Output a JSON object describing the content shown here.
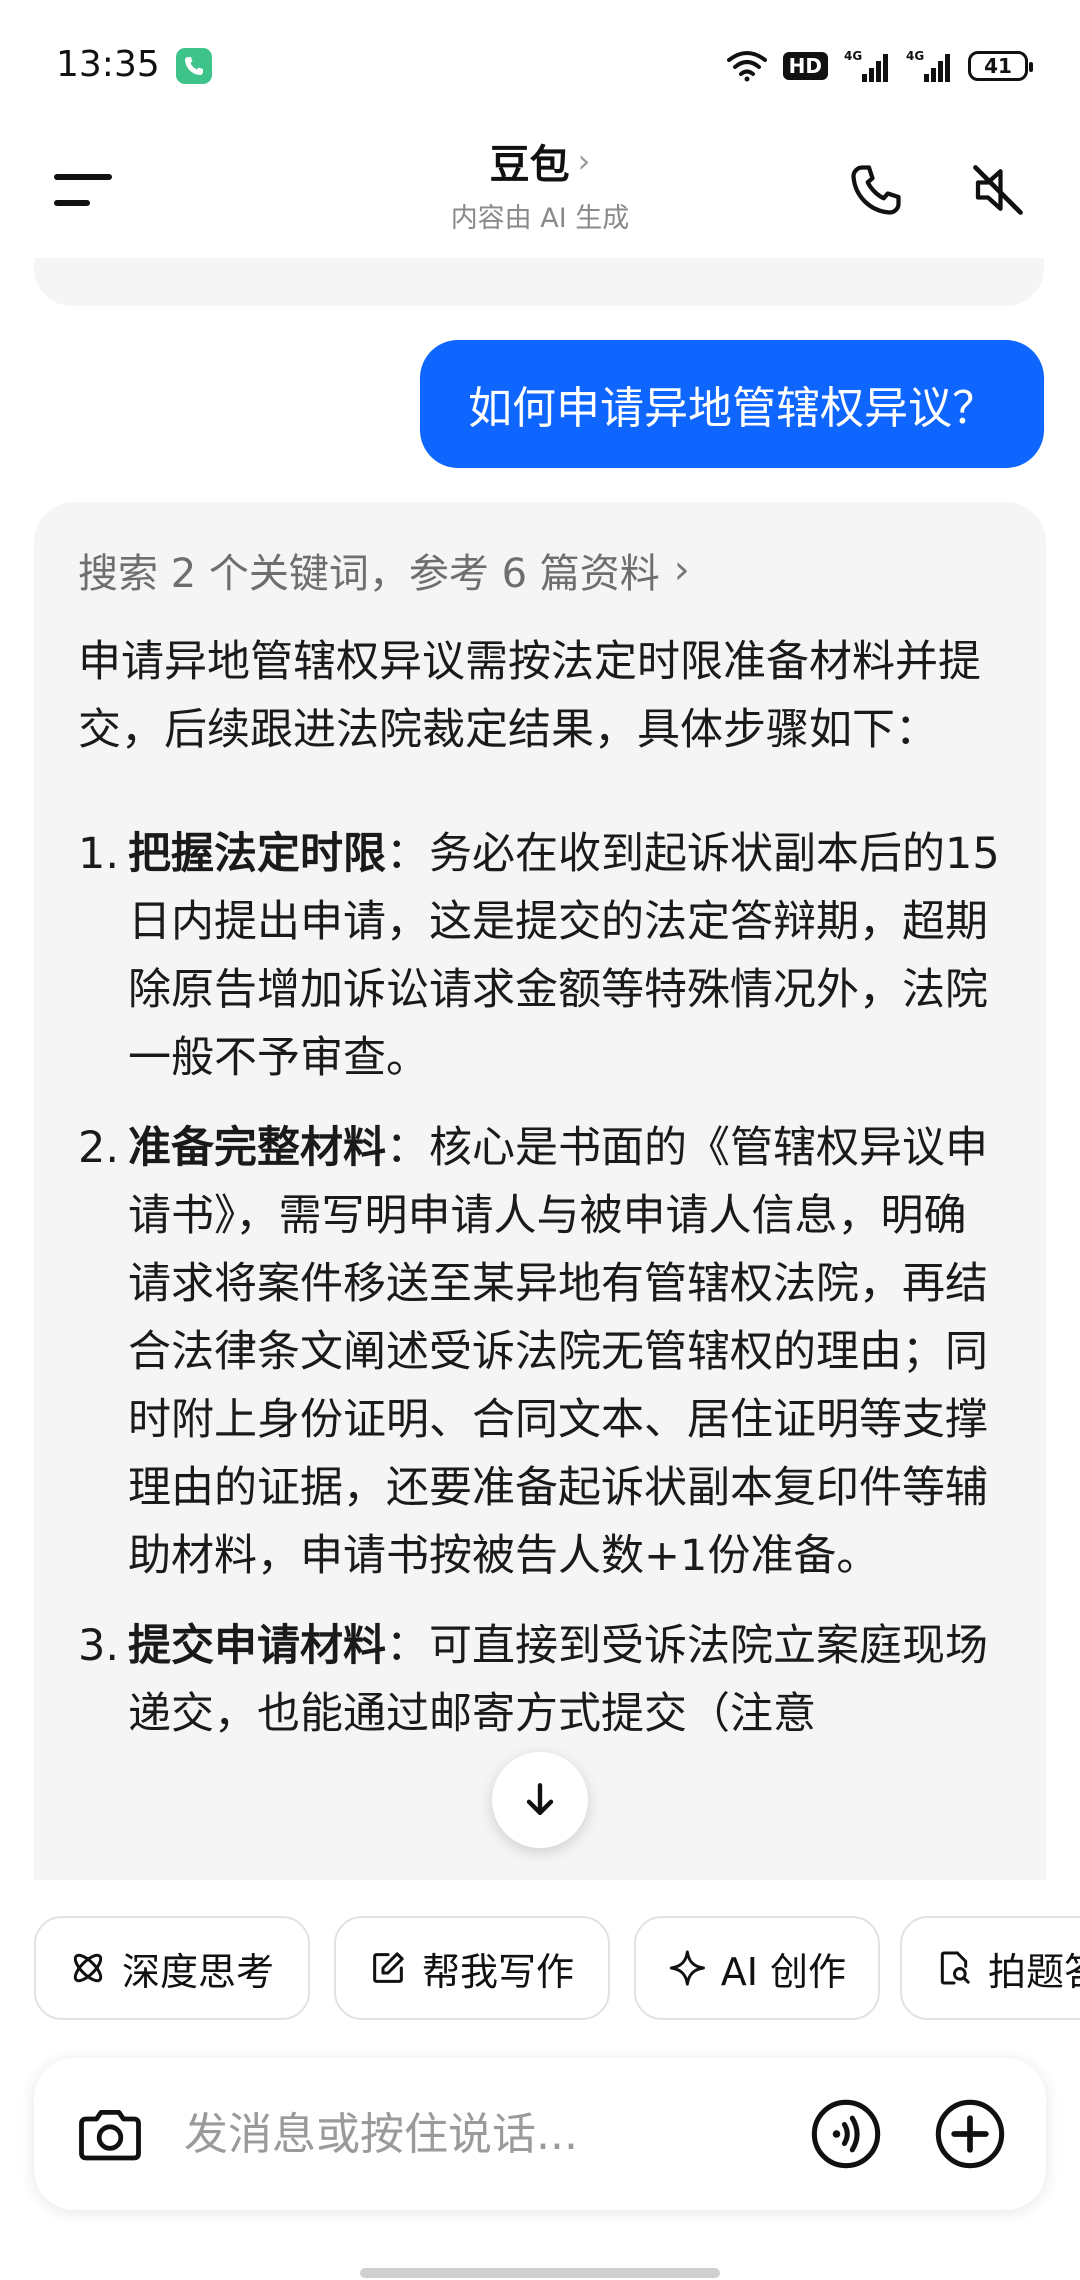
{
  "status_bar": {
    "time": "13:35",
    "hd_label": "HD",
    "battery_level": "41",
    "icons": [
      "phone-icon",
      "wifi-icon",
      "signal-4g-icon",
      "signal-4g-icon",
      "battery-icon"
    ]
  },
  "header": {
    "title": "豆包",
    "title_chevron": "›",
    "subtitle": "内容由 AI 生成"
  },
  "chat": {
    "user_message": "如何申请异地管辖权异议？",
    "ai_reply": {
      "search_summary": "搜索 2 个关键词，参考 6 篇资料",
      "intro": "申请异地管辖权异议需按法定时限准备材料并提交，后续跟进法院裁定结果，具体步骤如下：",
      "steps": [
        {
          "num": "1.",
          "title": "把握法定时限",
          "text": "：务必在收到起诉状副本后的15日内提出申请，这是提交的法定答辩期，超期除原告增加诉讼请求金额等特殊情况外，法院一般不予审查。"
        },
        {
          "num": "2.",
          "title": "准备完整材料",
          "text": "：核心是书面的《管辖权异议申请书》，需写明申请人与被申请人信息，明确请求将案件移送至某异地有管辖权法院，再结合法律条文阐述受诉法院无管辖权的理由；同时附上身份证明、合同文本、居住证明等支撑理由的证据，还要准备起诉状副本复印件等辅助材料，申请书按被告人数+1份准备。"
        },
        {
          "num": "3.",
          "title": "提交申请材料",
          "text": "：可直接到受诉法院立案庭现场递交，也能通过邮寄方式提交（注意"
        }
      ]
    }
  },
  "quick_actions": [
    {
      "label": "深度思考",
      "icon": "deep-think-icon"
    },
    {
      "label": "帮我写作",
      "icon": "edit-icon"
    },
    {
      "label": "AI 创作",
      "icon": "sparkle-icon"
    },
    {
      "label": "拍题答疑",
      "icon": "scan-doc-icon"
    }
  ],
  "input": {
    "placeholder": "发消息或按住说话..."
  },
  "colors": {
    "accent": "#0f66ff",
    "card_bg": "#f5f5f5",
    "call_chip": "#3ec48a"
  }
}
